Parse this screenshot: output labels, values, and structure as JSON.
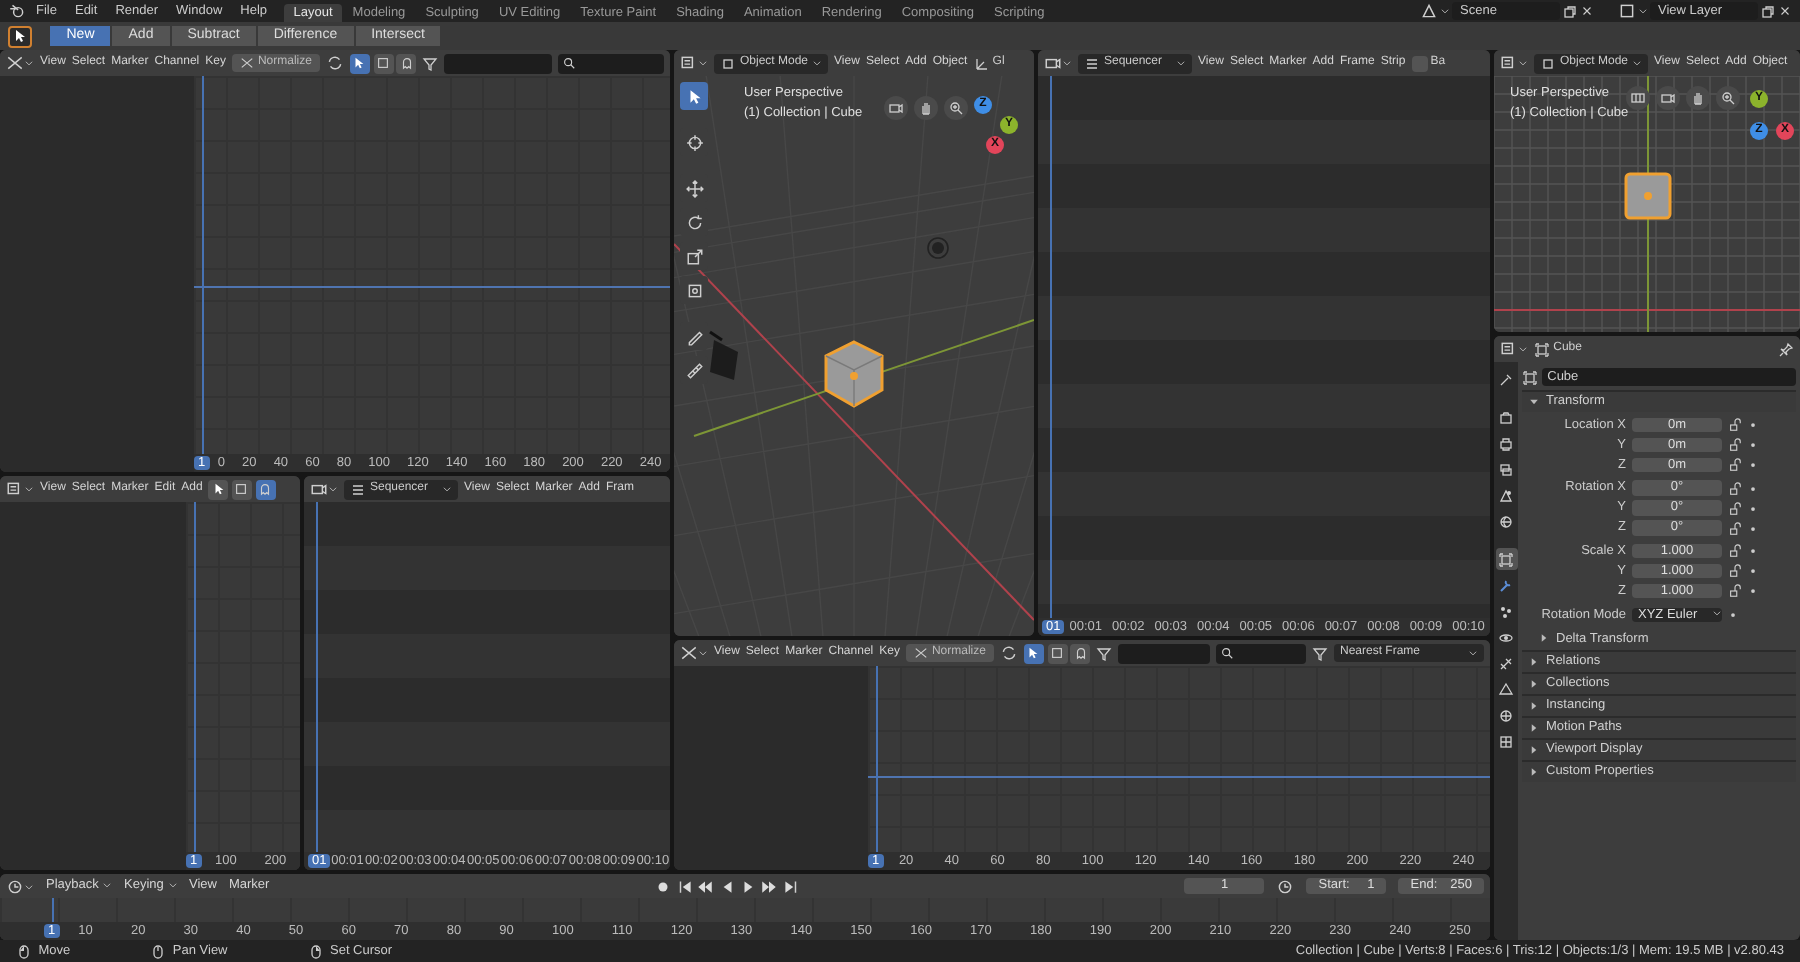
{
  "top_bar": {
    "menus": [
      "File",
      "Edit",
      "Render",
      "Window",
      "Help"
    ],
    "workspaces": [
      {
        "label": "Layout",
        "selected": true
      },
      {
        "label": "Modeling",
        "selected": false
      },
      {
        "label": "Sculpting",
        "selected": false
      },
      {
        "label": "UV Editing",
        "selected": false
      },
      {
        "label": "Texture Paint",
        "selected": false
      },
      {
        "label": "Shading",
        "selected": false
      },
      {
        "label": "Animation",
        "selected": false
      },
      {
        "label": "Rendering",
        "selected": false
      },
      {
        "label": "Compositing",
        "selected": false
      },
      {
        "label": "Scripting",
        "selected": false
      }
    ],
    "scene": "Scene",
    "view_layer": "View Layer"
  },
  "tool_header": {
    "modes": [
      {
        "label": "New",
        "selected": true
      },
      {
        "label": "Add",
        "selected": false
      },
      {
        "label": "Subtract",
        "selected": false
      },
      {
        "label": "Difference",
        "selected": false
      },
      {
        "label": "Intersect",
        "selected": false
      }
    ]
  },
  "graph_editor_top": {
    "menus": [
      "View",
      "Select",
      "Marker",
      "Channel",
      "Key"
    ],
    "normalize": {
      "label": "Normalize",
      "on": false
    },
    "toggles": [
      {
        "on": true
      },
      {
        "on": false
      },
      {
        "on": false
      }
    ],
    "playhead": "1",
    "ruler": [
      "0",
      "20",
      "40",
      "60",
      "80",
      "100",
      "120",
      "140",
      "160",
      "180",
      "200",
      "220",
      "240"
    ]
  },
  "dope_sheet": {
    "menus": [
      "View",
      "Select",
      "Marker",
      "Edit",
      "Add"
    ],
    "toggles": [
      {
        "on": false
      },
      {
        "on": false
      },
      {
        "on": true
      }
    ],
    "playhead": "1",
    "ruler": [
      "100",
      "200"
    ]
  },
  "sequencer_left": {
    "type": "Sequencer",
    "menus": [
      "View",
      "Select",
      "Marker",
      "Add",
      "Fram"
    ],
    "playhead": "01",
    "ruler": [
      "00:01",
      "00:02",
      "00:03",
      "00:04",
      "00:05",
      "00:06",
      "00:07",
      "00:08",
      "00:09",
      "00:10"
    ]
  },
  "viewport": {
    "mode": "Object Mode",
    "menus": [
      "View",
      "Select",
      "Add",
      "Object"
    ],
    "orientation": "Gl",
    "overlay": [
      "User Perspective",
      "(1) Collection | Cube"
    ],
    "tools": [
      {
        "kind": "select",
        "selected": true
      },
      {
        "kind": "cursor",
        "selected": false
      },
      {
        "kind": "move",
        "selected": false
      },
      {
        "kind": "rotate",
        "selected": false
      },
      {
        "kind": "scale",
        "selected": false
      },
      {
        "kind": "transform",
        "selected": false
      },
      {
        "kind": "annotate",
        "selected": false
      },
      {
        "kind": "measure",
        "selected": false
      }
    ],
    "gizmo": {
      "x": "X",
      "y": "Y",
      "z": "Z"
    }
  },
  "sequencer_right": {
    "type": "Sequencer",
    "menus": [
      "View",
      "Select",
      "Marker",
      "Add",
      "Frame",
      "Strip"
    ],
    "backdrop": {
      "label": "Ba",
      "checked": false
    },
    "playhead": "01",
    "ruler": [
      "00:01",
      "00:02",
      "00:03",
      "00:04",
      "00:05",
      "00:06",
      "00:07",
      "00:08",
      "00:09",
      "00:10"
    ]
  },
  "viewport_small": {
    "mode": "Object Mode",
    "menus": [
      "View",
      "Select",
      "Add",
      "Object"
    ],
    "overlay": [
      "User Perspective",
      "(1) Collection | Cube"
    ],
    "gizmo": {
      "x": "X",
      "y": "Y",
      "z": "Z"
    }
  },
  "properties": {
    "object": "Cube",
    "name": "Cube",
    "tabs": [
      {
        "kind": "tool",
        "selected": false
      },
      {
        "kind": "render",
        "selected": false
      },
      {
        "kind": "output",
        "selected": false
      },
      {
        "kind": "view-layer",
        "selected": false
      },
      {
        "kind": "scene",
        "selected": false
      },
      {
        "kind": "world",
        "selected": false
      },
      {
        "kind": "object",
        "selected": true
      },
      {
        "kind": "modifiers",
        "selected": false
      },
      {
        "kind": "particles",
        "selected": false
      },
      {
        "kind": "physics",
        "selected": false
      },
      {
        "kind": "constraints",
        "selected": false
      },
      {
        "kind": "data",
        "selected": false
      },
      {
        "kind": "material",
        "selected": false
      },
      {
        "kind": "texture",
        "selected": false
      }
    ],
    "transform": {
      "title": "Transform",
      "expanded": true,
      "groups": [
        {
          "rows": [
            {
              "label": "Location X",
              "value": "0m",
              "locked": false
            },
            {
              "label": "Y",
              "value": "0m",
              "locked": false
            },
            {
              "label": "Z",
              "value": "0m",
              "locked": false
            }
          ]
        },
        {
          "rows": [
            {
              "label": "Rotation X",
              "value": "0°",
              "locked": false
            },
            {
              "label": "Y",
              "value": "0°",
              "locked": false
            },
            {
              "label": "Z",
              "value": "0°",
              "locked": false
            }
          ]
        },
        {
          "rows": [
            {
              "label": "Scale X",
              "value": "1.000",
              "locked": false
            },
            {
              "label": "Y",
              "value": "1.000",
              "locked": false
            },
            {
              "label": "Z",
              "value": "1.000",
              "locked": false
            }
          ]
        }
      ],
      "rotation_mode": {
        "label": "Rotation Mode",
        "value": "XYZ Euler"
      },
      "subpanel": {
        "title": "Delta Transform",
        "expanded": false
      }
    },
    "panels": [
      {
        "title": "Relations",
        "expanded": false
      },
      {
        "title": "Collections",
        "expanded": false
      },
      {
        "title": "Instancing",
        "expanded": false
      },
      {
        "title": "Motion Paths",
        "expanded": false
      },
      {
        "title": "Viewport Display",
        "expanded": false
      },
      {
        "title": "Custom Properties",
        "expanded": false
      }
    ]
  },
  "graph_editor_bottom": {
    "menus": [
      "View",
      "Select",
      "Marker",
      "Channel",
      "Key"
    ],
    "normalize": {
      "label": "Normalize",
      "on": false
    },
    "toggles": [
      {
        "on": true
      },
      {
        "on": false
      },
      {
        "on": false
      }
    ],
    "snap": "Nearest Frame",
    "playhead": "1",
    "ruler": [
      "20",
      "40",
      "60",
      "80",
      "100",
      "120",
      "140",
      "160",
      "180",
      "200",
      "220",
      "240"
    ]
  },
  "timeline": {
    "menus": [
      {
        "label": "Playback",
        "dropdown": true
      },
      {
        "label": "Keying",
        "dropdown": true
      },
      {
        "label": "View",
        "dropdown": false
      },
      {
        "label": "Marker",
        "dropdown": false
      }
    ],
    "transport": [
      {
        "kind": "record"
      },
      {
        "kind": "jump-start"
      },
      {
        "kind": "prev-key"
      },
      {
        "kind": "play-reverse"
      },
      {
        "kind": "play"
      },
      {
        "kind": "next-key"
      },
      {
        "kind": "jump-end"
      }
    ],
    "frame": "1",
    "start_label": "Start:",
    "start": "1",
    "end_label": "End:",
    "end": "250",
    "playhead": "1",
    "ruler": [
      "10",
      "20",
      "30",
      "40",
      "50",
      "60",
      "70",
      "80",
      "90",
      "100",
      "110",
      "120",
      "130",
      "140",
      "150",
      "160",
      "170",
      "180",
      "190",
      "200",
      "210",
      "220",
      "230",
      "240",
      "250"
    ]
  },
  "status_bar": {
    "hints": [
      {
        "kind": "mouse-left",
        "label": "Move"
      },
      {
        "kind": "mouse-middle",
        "label": "Pan View"
      },
      {
        "kind": "mouse-right",
        "label": "Set Cursor"
      }
    ],
    "stats": "Collection | Cube | Verts:8 | Faces:6 | Tris:12 | Objects:1/3 | Mem: 19.5 MB | v2.80.43"
  }
}
